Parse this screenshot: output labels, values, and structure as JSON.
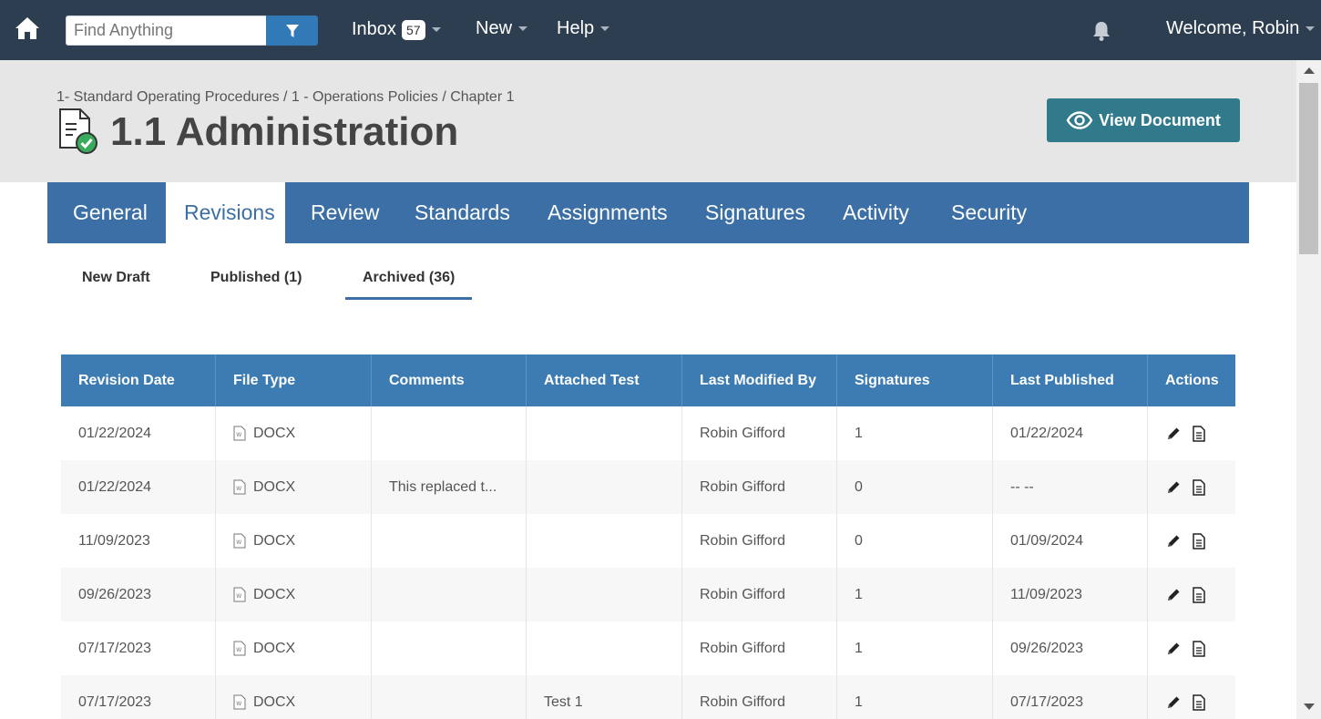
{
  "topnav": {
    "search_placeholder": "Find Anything",
    "inbox_label": "Inbox",
    "inbox_count": "57",
    "new_label": "New",
    "help_label": "Help",
    "welcome_label": "Welcome, Robin",
    "icons": [
      "home-icon",
      "filter-icon",
      "bell-icon"
    ]
  },
  "header": {
    "breadcrumb": "1- Standard Operating Procedures / 1 - Operations Policies / Chapter 1",
    "title": "1.1 Administration",
    "view_button": "View Document"
  },
  "tabs": [
    {
      "label": "General"
    },
    {
      "label": "Revisions"
    },
    {
      "label": "Review"
    },
    {
      "label": "Standards"
    },
    {
      "label": "Assignments"
    },
    {
      "label": "Signatures"
    },
    {
      "label": "Activity"
    },
    {
      "label": "Security"
    }
  ],
  "active_tab": "Revisions",
  "subtabs": [
    {
      "label": "New Draft"
    },
    {
      "label": "Published (1)"
    },
    {
      "label": "Archived (36)"
    }
  ],
  "active_subtab": "Archived (36)",
  "table": {
    "columns": [
      "Revision Date",
      "File Type",
      "Comments",
      "Attached Test",
      "Last Modified By",
      "Signatures",
      "Last Published",
      "Actions"
    ],
    "rows": [
      {
        "date": "01/22/2024",
        "type": "DOCX",
        "comments": "",
        "test": "",
        "modified_by": "Robin Gifford",
        "signatures": "1",
        "published": "01/22/2024"
      },
      {
        "date": "01/22/2024",
        "type": "DOCX",
        "comments": "This replaced t...",
        "test": "",
        "modified_by": "Robin Gifford",
        "signatures": "0",
        "published": "-- --"
      },
      {
        "date": "11/09/2023",
        "type": "DOCX",
        "comments": "",
        "test": "",
        "modified_by": "Robin Gifford",
        "signatures": "0",
        "published": "01/09/2024"
      },
      {
        "date": "09/26/2023",
        "type": "DOCX",
        "comments": "",
        "test": "",
        "modified_by": "Robin Gifford",
        "signatures": "1",
        "published": "11/09/2023"
      },
      {
        "date": "07/17/2023",
        "type": "DOCX",
        "comments": "",
        "test": "",
        "modified_by": "Robin Gifford",
        "signatures": "1",
        "published": "09/26/2023"
      },
      {
        "date": "07/17/2023",
        "type": "DOCX",
        "comments": "",
        "test": "Test 1",
        "modified_by": "Robin Gifford",
        "signatures": "1",
        "published": "07/17/2023"
      }
    ]
  },
  "colors": {
    "topnav": "#2d3e50",
    "filter_button": "#3279b7",
    "tabbar": "#3c6fa6",
    "table_header": "#3c7cb3",
    "view_button": "#317a8c"
  }
}
